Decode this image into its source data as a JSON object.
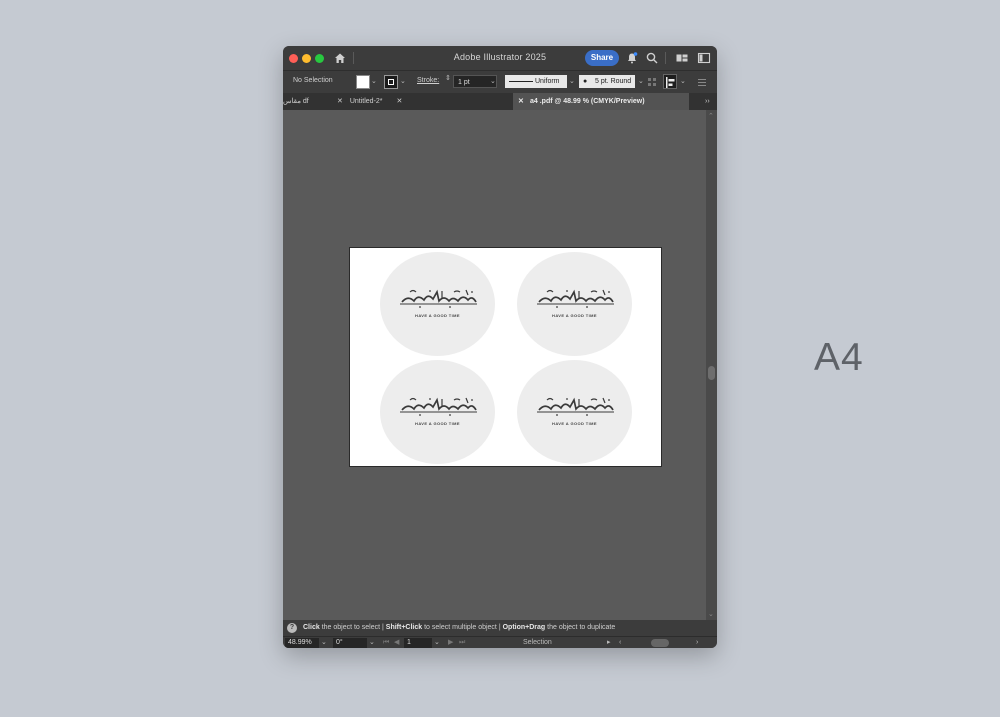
{
  "window": {
    "title": "Adobe Illustrator 2025",
    "share_label": "Share"
  },
  "controlbar": {
    "selection_label": "No Selection",
    "stroke_label": "Stroke:",
    "stroke_weight": "1 pt",
    "profile_label": "Uniform",
    "brush_label": "5 pt. Round"
  },
  "tabs": [
    {
      "label": "مقاس df"
    },
    {
      "label": "Untitled-2*"
    },
    {
      "label": "a4 .pdf @ 48.99 % (CMYK/Preview)"
    }
  ],
  "artwork": {
    "tagline": "HAVE A GOOD TIME",
    "coasters": 4
  },
  "status": {
    "hint_1_key": "Click",
    "hint_1_text": "the object to select  |",
    "hint_2_key": "Shift+Click",
    "hint_2_text": "to select multiple object  |",
    "hint_3_key": "Option+Drag",
    "hint_3_text": "the object to duplicate"
  },
  "bottombar": {
    "zoom": "48.99%",
    "rotation": "0°",
    "artboard_number": "1",
    "tool": "Selection"
  },
  "page_label": "A4",
  "colors": {
    "background": "#c5cad2",
    "share_accent": "#3a6ec7",
    "coaster_fill": "#ededed"
  }
}
